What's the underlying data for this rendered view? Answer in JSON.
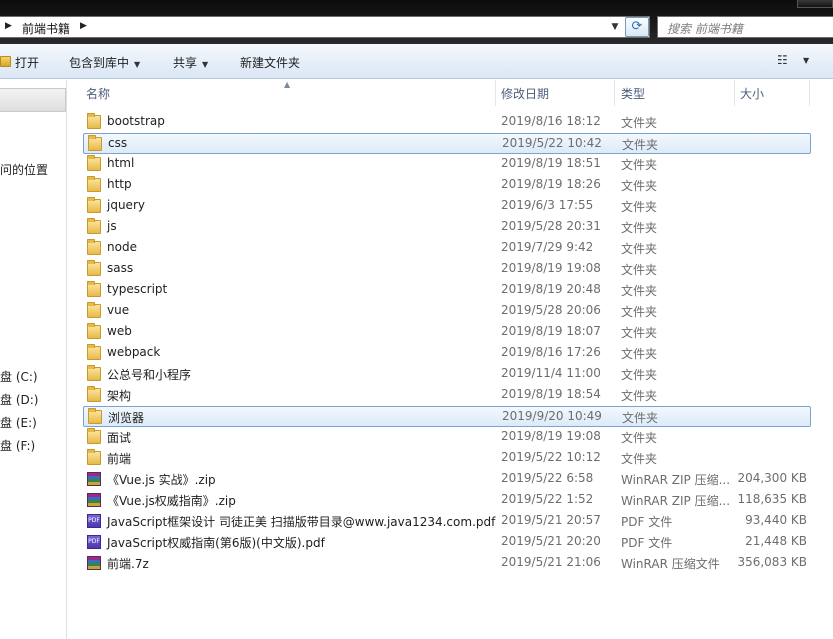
{
  "address": {
    "crumb": "前端书籍"
  },
  "search": {
    "placeholder": "搜索 前端书籍"
  },
  "toolbar": {
    "open": "打开",
    "include": "包含到库中",
    "share": "共享",
    "new_folder": "新建文件夹"
  },
  "nav": {
    "location": "问的位置",
    "drives": [
      "盘 (C:)",
      "盘 (D:)",
      "盘 (E:)",
      "盘 (F:)"
    ]
  },
  "columns": {
    "name": "名称",
    "date": "修改日期",
    "type": "类型",
    "size": "大小"
  },
  "files": [
    {
      "name": "bootstrap",
      "date": "2019/8/16 18:12",
      "type": "文件夹",
      "size": "",
      "icon": "folder-icon",
      "selected": false
    },
    {
      "name": "css",
      "date": "2019/5/22 10:42",
      "type": "文件夹",
      "size": "",
      "icon": "folder-icon",
      "selected": true
    },
    {
      "name": "html",
      "date": "2019/8/19 18:51",
      "type": "文件夹",
      "size": "",
      "icon": "folder-icon",
      "selected": false
    },
    {
      "name": "http",
      "date": "2019/8/19 18:26",
      "type": "文件夹",
      "size": "",
      "icon": "folder-icon",
      "selected": false
    },
    {
      "name": "jquery",
      "date": "2019/6/3 17:55",
      "type": "文件夹",
      "size": "",
      "icon": "folder-icon",
      "selected": false
    },
    {
      "name": "js",
      "date": "2019/5/28 20:31",
      "type": "文件夹",
      "size": "",
      "icon": "folder-icon",
      "selected": false
    },
    {
      "name": "node",
      "date": "2019/7/29 9:42",
      "type": "文件夹",
      "size": "",
      "icon": "folder-icon",
      "selected": false
    },
    {
      "name": "sass",
      "date": "2019/8/19 19:08",
      "type": "文件夹",
      "size": "",
      "icon": "folder-icon",
      "selected": false
    },
    {
      "name": "typescript",
      "date": "2019/8/19 20:48",
      "type": "文件夹",
      "size": "",
      "icon": "folder-icon",
      "selected": false
    },
    {
      "name": "vue",
      "date": "2019/5/28 20:06",
      "type": "文件夹",
      "size": "",
      "icon": "folder-icon",
      "selected": false
    },
    {
      "name": "web",
      "date": "2019/8/19 18:07",
      "type": "文件夹",
      "size": "",
      "icon": "folder-icon",
      "selected": false
    },
    {
      "name": "webpack",
      "date": "2019/8/16 17:26",
      "type": "文件夹",
      "size": "",
      "icon": "folder-icon",
      "selected": false
    },
    {
      "name": "公总号和小程序",
      "date": "2019/11/4 11:00",
      "type": "文件夹",
      "size": "",
      "icon": "folder-icon",
      "selected": false
    },
    {
      "name": "架构",
      "date": "2019/8/19 18:54",
      "type": "文件夹",
      "size": "",
      "icon": "folder-icon",
      "selected": false
    },
    {
      "name": "浏览器",
      "date": "2019/9/20 10:49",
      "type": "文件夹",
      "size": "",
      "icon": "folder-icon",
      "selected": true
    },
    {
      "name": "面试",
      "date": "2019/8/19 19:08",
      "type": "文件夹",
      "size": "",
      "icon": "folder-icon",
      "selected": false
    },
    {
      "name": "前端",
      "date": "2019/5/22 10:12",
      "type": "文件夹",
      "size": "",
      "icon": "folder-icon",
      "selected": false
    },
    {
      "name": "《Vue.js 实战》.zip",
      "date": "2019/5/22 6:58",
      "type": "WinRAR ZIP 压缩...",
      "size": "204,300 KB",
      "icon": "rar-icon",
      "selected": false
    },
    {
      "name": "《Vue.js权威指南》.zip",
      "date": "2019/5/22 1:52",
      "type": "WinRAR ZIP 压缩...",
      "size": "118,635 KB",
      "icon": "rar-icon",
      "selected": false
    },
    {
      "name": "JavaScript框架设计 司徒正美 扫描版带目录@www.java1234.com.pdf",
      "date": "2019/5/21 20:57",
      "type": "PDF 文件",
      "size": "93,440 KB",
      "icon": "pdf-icon",
      "selected": false
    },
    {
      "name": "JavaScript权威指南(第6版)(中文版).pdf",
      "date": "2019/5/21 20:20",
      "type": "PDF 文件",
      "size": "21,448 KB",
      "icon": "pdf-icon",
      "selected": false
    },
    {
      "name": "前端.7z",
      "date": "2019/5/21 21:06",
      "type": "WinRAR 压缩文件",
      "size": "356,083 KB",
      "icon": "rar-icon",
      "selected": false
    }
  ]
}
